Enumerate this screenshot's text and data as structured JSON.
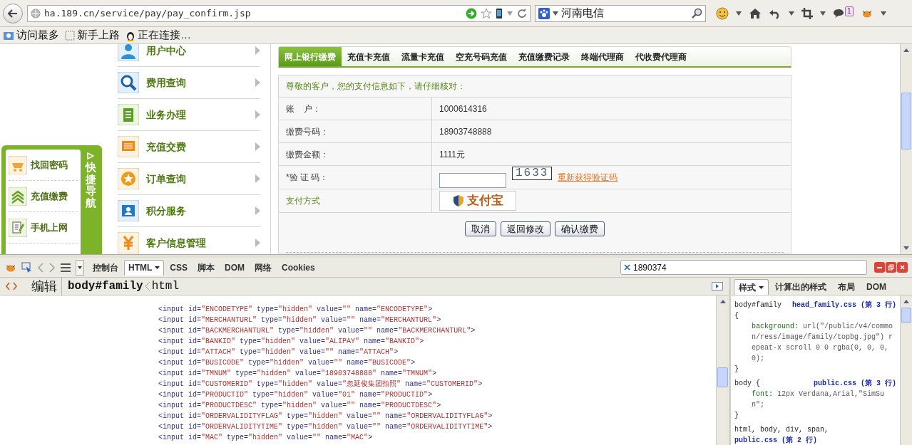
{
  "browser": {
    "url": "ha.189.cn/service/pay/pay_confirm.jsp",
    "search": "河南电信",
    "notification_count": "1"
  },
  "bookmarks": [
    {
      "label": "访问最多"
    },
    {
      "label": "新手上路"
    },
    {
      "label": "正在连接…"
    }
  ],
  "quick_nav": {
    "title": "快捷导航",
    "items": [
      {
        "label": "找回密码"
      },
      {
        "label": "充值缴费"
      },
      {
        "label": "手机上网"
      }
    ]
  },
  "menu": [
    {
      "label": "用户中心"
    },
    {
      "label": "费用查询"
    },
    {
      "label": "业务办理"
    },
    {
      "label": "充值交费"
    },
    {
      "label": "订单查询"
    },
    {
      "label": "积分服务"
    },
    {
      "label": "客户信息管理"
    }
  ],
  "tabs": [
    {
      "label": "网上银行缴费",
      "selected": true
    },
    {
      "label": "充值卡充值",
      "selected": false
    },
    {
      "label": "流量卡充值",
      "selected": false
    },
    {
      "label": "空充号码充值",
      "selected": false
    },
    {
      "label": "充值缴费记录",
      "selected": false
    },
    {
      "label": "终端代理商",
      "selected": false
    },
    {
      "label": "代收费代理商",
      "selected": false
    }
  ],
  "form": {
    "intro": "尊敬的客户，您的支付信息如下，请仔细核对：",
    "rows": [
      {
        "kind": "text",
        "label": "账    户：",
        "value": "1000614316",
        "accent": false
      },
      {
        "kind": "text",
        "label": "缴费号码：",
        "value": "18903748888",
        "accent": false
      },
      {
        "kind": "text",
        "label": "缴费金额：",
        "value": "1111元",
        "accent": false
      },
      {
        "kind": "captcha",
        "label": "*验 证 码：",
        "captcha": "1633",
        "refresh": "重新获得验证码",
        "accent": false
      },
      {
        "kind": "payment",
        "label": "支付方式",
        "logo": "支付宝",
        "accent": true
      }
    ],
    "buttons": [
      "取消",
      "返回修改",
      "确认缴费"
    ]
  },
  "devtools": {
    "tabs": [
      {
        "label": "控制台",
        "selected": false,
        "has_menu": false
      },
      {
        "label": "HTML",
        "selected": true,
        "has_menu": true
      },
      {
        "label": "CSS",
        "selected": false,
        "has_menu": false
      },
      {
        "label": "脚本",
        "selected": false,
        "has_menu": false
      },
      {
        "label": "DOM",
        "selected": false,
        "has_menu": false
      },
      {
        "label": "网络",
        "selected": false,
        "has_menu": false
      },
      {
        "label": "Cookies",
        "selected": false,
        "has_menu": false
      }
    ],
    "search": "1890374",
    "edit": "编辑",
    "breadcrumb": [
      "body#family",
      "html"
    ],
    "code_lines": [
      "<input id=\"ENCODETYPE\" type=\"hidden\" value=\"\" name=\"ENCODETYPE\">",
      "<input id=\"MERCHANTURL\" type=\"hidden\" value=\"\" name=\"MERCHANTURL\">",
      "<input id=\"BACKMERCHANTURL\" type=\"hidden\" value=\"\" name=\"BACKMERCHANTURL\">",
      "<input id=\"BANKID\" type=\"hidden\" value=\"ALIPAY\" name=\"BANKID\">",
      "<input id=\"ATTACH\" type=\"hidden\" value=\"\" name=\"ATTACH\">",
      "<input id=\"BUSICODE\" type=\"hidden\" value=\"\" name=\"BUSICODE\">",
      "<input id=\"TMNUM\" type=\"hidden\" value=\"18903748888\" name=\"TMNUM\">",
      "<input id=\"CUSTOMERID\" type=\"hidden\" value=\"忽延俊集团拍照\" name=\"CUSTOMERID\">",
      "<input id=\"PRODUCTID\" type=\"hidden\" value=\"01\" name=\"PRODUCTID\">",
      "<input id=\"PRODUCTDESC\" type=\"hidden\" value=\"\" name=\"PRODUCTDESC\">",
      "<input id=\"ORDERVALIDITYFLAG\" type=\"hidden\" value=\"\" name=\"ORDERVALIDITYFLAG\">",
      "<input id=\"ORDERVALIDITYTIME\" type=\"hidden\" value=\"\" name=\"ORDERVALIDITYTIME\">",
      "<input id=\"MAC\" type=\"hidden\" value=\"\" name=\"MAC\">"
    ],
    "side_tabs": [
      {
        "label": "样式",
        "selected": true,
        "has_menu": true
      },
      {
        "label": "计算出的样式",
        "selected": false,
        "has_menu": false
      },
      {
        "label": "布局",
        "selected": false,
        "has_menu": false
      },
      {
        "label": "DOM",
        "selected": false,
        "has_menu": false
      }
    ],
    "css_rules": [
      {
        "selector": "body#family",
        "source": "head_family.css (第 3 行)",
        "open": "{",
        "declarations": [
          "background: url(\"/public/v4/common/ress/image/family/topbg.jpg\") repeat-x scroll 0 0 rgba(0, 0, 0, 0);"
        ],
        "close": "}"
      },
      {
        "selector": "body {",
        "source": "public.css (第 3 行)",
        "declarations": [
          "font: 12px Verdana,Arial,\"SimSun\";"
        ],
        "close": "}"
      },
      {
        "selector": "html, body, div, span,",
        "source": "public.css (第 2 行)"
      }
    ]
  }
}
